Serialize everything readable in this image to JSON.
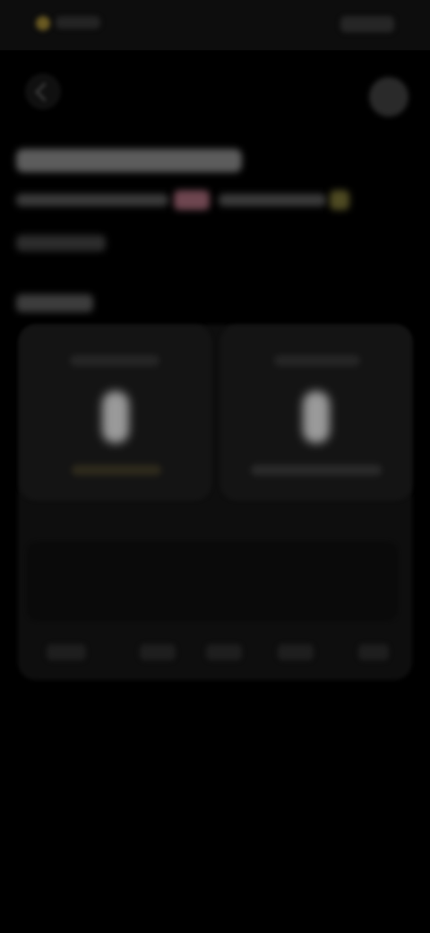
{
  "status_bar": {
    "left_text": "",
    "right_text": ""
  },
  "header": {
    "title": "",
    "info_text_1": "",
    "info_text_2": "",
    "subtitle": ""
  },
  "section": {
    "title": ""
  },
  "devices": [
    {
      "label": "",
      "status": ""
    },
    {
      "label": "",
      "status": ""
    }
  ],
  "tabs": [
    {
      "label": ""
    },
    {
      "label": ""
    },
    {
      "label": ""
    },
    {
      "label": ""
    },
    {
      "label": ""
    }
  ],
  "colors": {
    "background": "#000000",
    "status_accent": "#6a5a22",
    "badge_pink": "#6e4650",
    "badge_yellow": "#4e4a22"
  },
  "icons": {
    "status": "status-dot-icon",
    "back": "chevron-left-icon",
    "avatar": "avatar-icon",
    "device": "device-icon"
  }
}
